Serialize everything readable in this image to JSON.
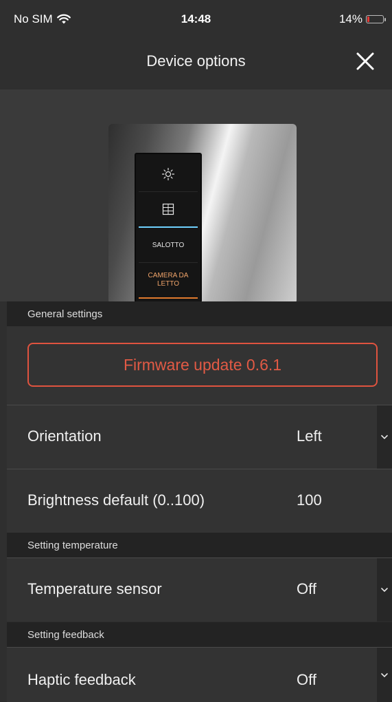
{
  "status": {
    "carrier": "No SIM",
    "time": "14:48",
    "battery": "14%",
    "battery_level": 0.14
  },
  "header": {
    "title": "Device options"
  },
  "device_image": {
    "keys": [
      "SALOTTO",
      "CAMERA DA LETTO"
    ]
  },
  "sections": {
    "general": "General settings",
    "temperature": "Setting temperature",
    "feedback": "Setting feedback"
  },
  "firmware": {
    "label": "Firmware update 0.6.1"
  },
  "rows": {
    "orientation": {
      "label": "Orientation",
      "value": "Left"
    },
    "brightness": {
      "label": "Brightness default (0..100)",
      "value": "100"
    },
    "temperature_sensor": {
      "label": "Temperature sensor",
      "value": "Off"
    },
    "haptic_feedback": {
      "label": "Haptic feedback",
      "value": "Off"
    }
  },
  "colors": {
    "accent": "#e0533f",
    "background": "#2f2f2f",
    "row": "#333333",
    "section": "#232323"
  }
}
